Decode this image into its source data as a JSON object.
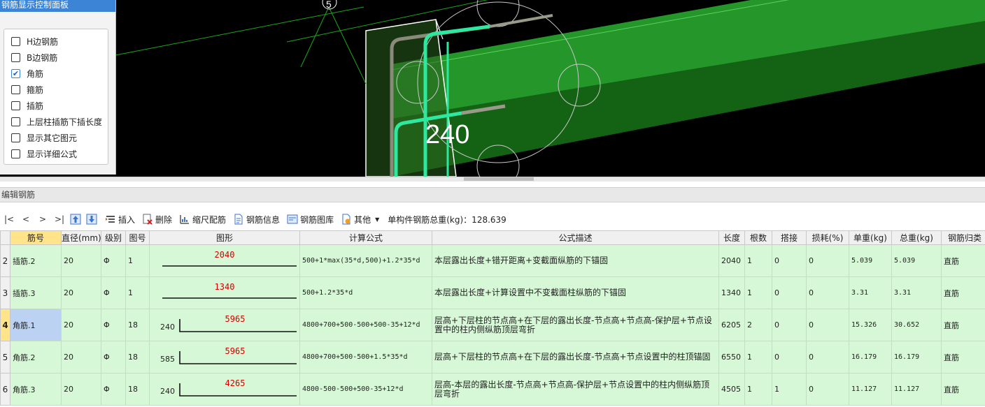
{
  "viewport": {
    "axis_label": "5",
    "dimension_label": "240",
    "colors": {
      "background": "#000000",
      "beam": "#1f8a1f",
      "rebar": "#2ee8a0",
      "guide": "#c8c8c8",
      "grid_line": "#1aa61a"
    }
  },
  "control_panel": {
    "title": "钢筋显示控制面板",
    "options": [
      {
        "label": "H边钢筋",
        "checked": false
      },
      {
        "label": "B边钢筋",
        "checked": false
      },
      {
        "label": "角筋",
        "checked": true
      },
      {
        "label": "箍筋",
        "checked": false
      },
      {
        "label": "插筋",
        "checked": false
      },
      {
        "label": "上层柱插筋下插长度",
        "checked": false
      },
      {
        "label": "显示其它图元",
        "checked": false
      },
      {
        "label": "显示详细公式",
        "checked": false
      }
    ]
  },
  "edit": {
    "title": "编辑钢筋",
    "toolbar": {
      "nav": [
        "|<",
        "<",
        ">",
        ">|"
      ],
      "insert": "插入",
      "delete": "删除",
      "scale_rebar": "缩尺配筋",
      "rebar_info": "钢筋信息",
      "rebar_library": "钢筋图库",
      "other": "其他",
      "total_weight": "单构件钢筋总重(kg)：128.639"
    },
    "columns": [
      "筋号",
      "直径(mm)",
      "级别",
      "图号",
      "图形",
      "计算公式",
      "公式描述",
      "长度",
      "根数",
      "搭接",
      "损耗(%)",
      "单重(kg)",
      "总重(kg)",
      "钢筋归类"
    ],
    "rows": [
      {
        "index": "2",
        "name": "插筋.2",
        "diameter": "20",
        "grade": "Φ",
        "figure_no": "1",
        "shape_lead": "",
        "shape_value": "2040",
        "formula": "500+1*max(35*d,500)+1.2*35*d",
        "description": "本层露出长度+错开距离+变截面纵筋的下锚固",
        "length": "2040",
        "count": "1",
        "lap": "0",
        "loss": "0",
        "unit_weight": "5.039",
        "total_weight": "5.039",
        "category": "直筋"
      },
      {
        "index": "3",
        "name": "插筋.3",
        "diameter": "20",
        "grade": "Φ",
        "figure_no": "1",
        "shape_lead": "",
        "shape_value": "1340",
        "formula": "500+1.2*35*d",
        "description": "本层露出长度+计算设置中不变截面柱纵筋的下锚固",
        "length": "1340",
        "count": "1",
        "lap": "0",
        "loss": "0",
        "unit_weight": "3.31",
        "total_weight": "3.31",
        "category": "直筋"
      },
      {
        "index": "4",
        "name": "角筋.1",
        "diameter": "20",
        "grade": "Φ",
        "figure_no": "18",
        "shape_lead": "240",
        "shape_value": "5965",
        "formula": "4800+700+500-500+500-35+12*d",
        "description": "层高+下层柱的节点高+在下层的露出长度-节点高+节点高-保护层+节点设置中的柱内侧纵筋顶层弯折",
        "length": "6205",
        "count": "2",
        "lap": "0",
        "loss": "0",
        "unit_weight": "15.326",
        "total_weight": "30.652",
        "category": "直筋"
      },
      {
        "index": "5",
        "name": "角筋.2",
        "diameter": "20",
        "grade": "Φ",
        "figure_no": "18",
        "shape_lead": "585",
        "shape_value": "5965",
        "formula": "4800+700+500-500+1.5*35*d",
        "description": "层高+下层柱的节点高+在下层的露出长度-节点高+节点设置中的柱顶锚固",
        "length": "6550",
        "count": "1",
        "lap": "0",
        "loss": "0",
        "unit_weight": "16.179",
        "total_weight": "16.179",
        "category": "直筋"
      },
      {
        "index": "6",
        "name": "角筋.3",
        "diameter": "20",
        "grade": "Φ",
        "figure_no": "18",
        "shape_lead": "240",
        "shape_value": "4265",
        "formula": "4800-500-500+500-35+12*d",
        "description": "层高-本层的露出长度-节点高+节点高-保护层+节点设置中的柱内侧纵筋顶层弯折",
        "length": "4505",
        "count": "1",
        "lap": "1",
        "loss": "0",
        "unit_weight": "11.127",
        "total_weight": "11.127",
        "category": "直筋"
      }
    ]
  }
}
